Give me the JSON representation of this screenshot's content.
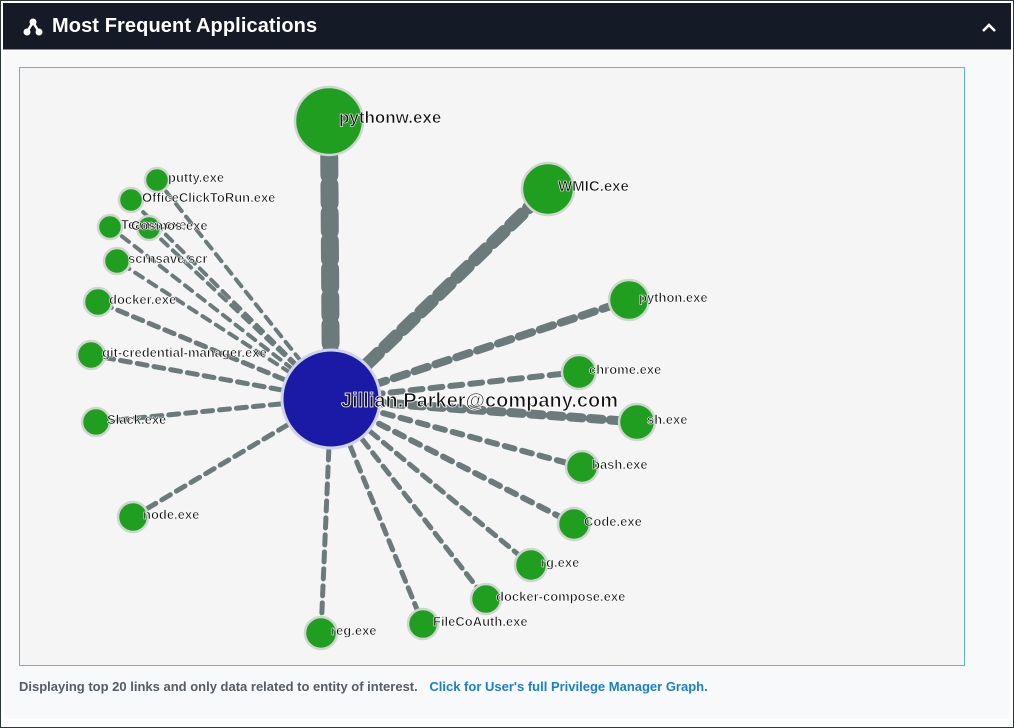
{
  "header": {
    "title": "Most Frequent Applications",
    "icon": "graph-nodes-icon",
    "collapse_icon": "chevron-up-icon"
  },
  "graph": {
    "center": {
      "label": "Jillian.Parker@company.com",
      "color": "#1a1aa6"
    },
    "node_color": "#1f9e1f",
    "edge_color": "#6b7b7b",
    "nodes": [
      {
        "label": "pythonw.exe"
      },
      {
        "label": "WMIC.exe"
      },
      {
        "label": "python.exe"
      },
      {
        "label": "chrome.exe"
      },
      {
        "label": "sh.exe"
      },
      {
        "label": "bash.exe"
      },
      {
        "label": "Code.exe"
      },
      {
        "label": "rg.exe"
      },
      {
        "label": "docker-compose.exe"
      },
      {
        "label": "FileCoAuth.exe"
      },
      {
        "label": "reg.exe"
      },
      {
        "label": "node.exe"
      },
      {
        "label": "Slack.exe"
      },
      {
        "label": "git-credential-manager.exe"
      },
      {
        "label": "docker.exe"
      },
      {
        "label": "scrnsave.scr"
      },
      {
        "label": "Teams.exe"
      },
      {
        "label": "Cosmos.exe"
      },
      {
        "label": "OfficeClickToRun.exe"
      },
      {
        "label": "putty.exe"
      }
    ]
  },
  "footer": {
    "note": "Displaying top 20 links and only data related to entity of interest.",
    "link": "Click for User's full Privilege Manager Graph."
  }
}
